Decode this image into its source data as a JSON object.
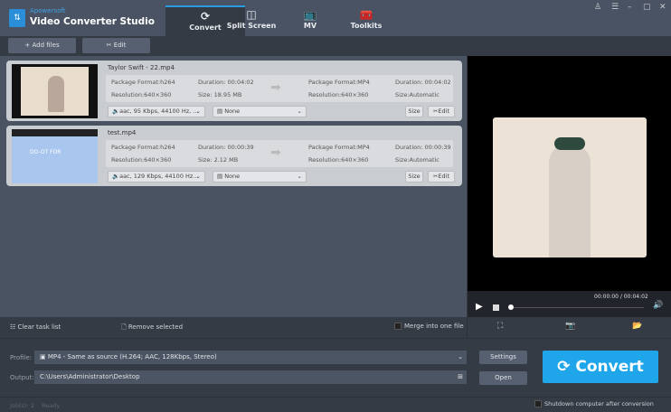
{
  "app": {
    "brand": "Apowersoft",
    "title": "Video Converter Studio"
  },
  "tabs": [
    {
      "label": "Convert",
      "icon": "refresh-icon"
    },
    {
      "label": "Split Screen",
      "icon": "split-screen-icon"
    },
    {
      "label": "MV",
      "icon": "tv-icon"
    },
    {
      "label": "Toolkits",
      "icon": "toolbox-icon"
    }
  ],
  "toolbar": {
    "add_files": "Add files",
    "edit": "Edit"
  },
  "files": [
    {
      "name": "Taylor Swift - 22.mp4",
      "src_format": "Package Format:h264",
      "src_duration": "Duration: 00:04:02",
      "src_resolution": "Resolution:640×360",
      "src_size": "Size: 18.95 MB",
      "out_format": "Package Format:MP4",
      "out_duration": "Duration: 00:04:02",
      "out_resolution": "Resolution:640×360",
      "out_size": "Size:Automatic",
      "audio": "aac, 95 Kbps, 44100 Hz, ...",
      "subtitle": "None",
      "size_btn": "Size",
      "edit_btn": "Edit"
    },
    {
      "name": "test.mp4",
      "src_format": "Package Format:h264",
      "src_duration": "Duration: 00:00:39",
      "src_resolution": "Resolution:640×360",
      "src_size": "Size: 2.12 MB",
      "out_format": "Package Format:MP4",
      "out_duration": "Duration: 00:00:39",
      "out_resolution": "Resolution:640×360",
      "out_size": "Size:Automatic",
      "audio": "aac, 129 Kbps, 44100 Hz...",
      "subtitle": "None",
      "size_btn": "Size",
      "edit_btn": "Edit"
    }
  ],
  "player": {
    "time": "00:00:00 / 00:04:02",
    "progress": 0
  },
  "actions": {
    "clear": "Clear task list",
    "remove": "Remove selected",
    "merge": "Merge into one file"
  },
  "profile": {
    "label": "Profile:",
    "value": "MP4 - Same as source (H.264; AAC, 128Kbps, Stereo)",
    "settings": "Settings"
  },
  "output": {
    "label": "Output:",
    "value": "C:\\Users\\Administrator\\Desktop",
    "open": "Open"
  },
  "convert": "Convert",
  "status": {
    "jobs": "Job(s): 2",
    "state": "Ready",
    "shutdown": "Shutdown computer after conversion"
  },
  "colors": {
    "accent": "#1ea5ea"
  }
}
